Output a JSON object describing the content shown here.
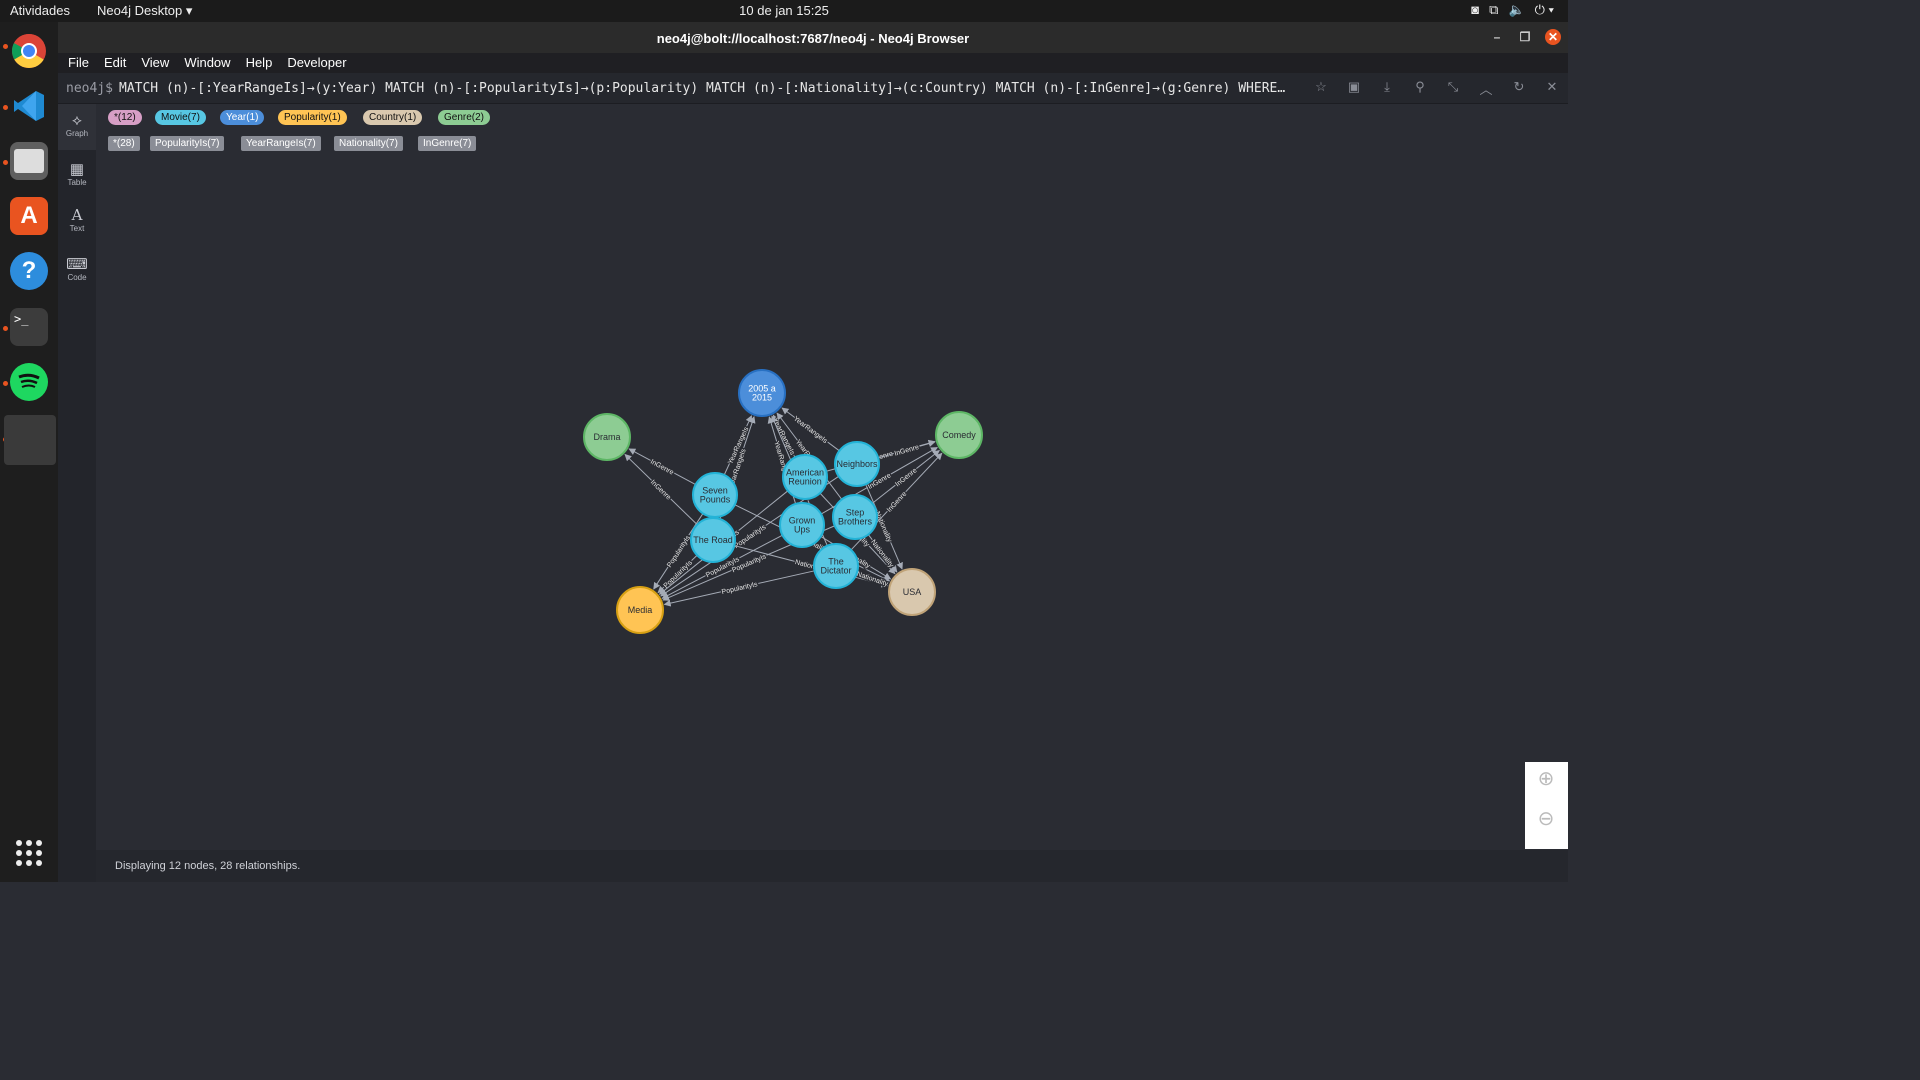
{
  "topbar": {
    "activities": "Atividades",
    "app_menu": "Neo4j Desktop ▾",
    "clock": "10 de jan  15:25"
  },
  "window": {
    "title": "neo4j@bolt://localhost:7687/neo4j - Neo4j Browser"
  },
  "menu": [
    "File",
    "Edit",
    "View",
    "Window",
    "Help",
    "Developer"
  ],
  "query": {
    "prompt": "neo4j$",
    "text": "MATCH (n)-[:YearRangeIs]→(y:Year) MATCH (n)-[:PopularityIs]→(p:Popularity) MATCH (n)-[:Nationality]→(c:Country) MATCH (n)-[:InGenre]→(g:Genre) WHERE…"
  },
  "view_modes": [
    "Graph",
    "Table",
    "Text",
    "Code"
  ],
  "node_labels": [
    {
      "text": "*(12)",
      "color": "#d79fc6"
    },
    {
      "text": "Movie(7)",
      "color": "#57c7e3"
    },
    {
      "text": "Year(1)",
      "color": "#4c8eda"
    },
    {
      "text": "Popularity(1)",
      "color": "#ffc454"
    },
    {
      "text": "Country(1)",
      "color": "#d9c8ae"
    },
    {
      "text": "Genre(2)",
      "color": "#8dcc93"
    }
  ],
  "rel_types": [
    "*(28)",
    "PopularityIs(7)",
    "YearRangeIs(7)",
    "Nationality(7)",
    "InGenre(7)"
  ],
  "graph": {
    "nodes": [
      {
        "id": "year",
        "label": [
          "2005 a",
          "2015"
        ],
        "color": "#4c8eda",
        "border": "#2870c2"
      },
      {
        "id": "drama",
        "label": [
          "Drama"
        ],
        "color": "#8dcc93",
        "border": "#5db665"
      },
      {
        "id": "comedy",
        "label": [
          "Comedy"
        ],
        "color": "#8dcc93",
        "border": "#5db665"
      },
      {
        "id": "media",
        "label": [
          "Media"
        ],
        "color": "#ffc454",
        "border": "#d7a013"
      },
      {
        "id": "usa",
        "label": [
          "USA"
        ],
        "color": "#d9c8ae",
        "border": "#c0a378"
      },
      {
        "id": "seven",
        "label": [
          "Seven",
          "Pounds"
        ],
        "color": "#57c7e3",
        "border": "#23b3d7"
      },
      {
        "id": "road",
        "label": [
          "The Road"
        ],
        "color": "#57c7e3",
        "border": "#23b3d7"
      },
      {
        "id": "american",
        "label": [
          "American",
          "Reunion"
        ],
        "color": "#57c7e3",
        "border": "#23b3d7"
      },
      {
        "id": "neighbors",
        "label": [
          "Neighbors"
        ],
        "color": "#57c7e3",
        "border": "#23b3d7"
      },
      {
        "id": "grown",
        "label": [
          "Grown",
          "Ups"
        ],
        "color": "#57c7e3",
        "border": "#23b3d7"
      },
      {
        "id": "step",
        "label": [
          "Step",
          "Brothers"
        ],
        "color": "#57c7e3",
        "border": "#23b3d7"
      },
      {
        "id": "dictator",
        "label": [
          "The",
          "Dictator"
        ],
        "color": "#57c7e3",
        "border": "#23b3d7"
      }
    ],
    "relationships": [
      {
        "from": "seven",
        "to": "year",
        "type": "YearRangeIs"
      },
      {
        "from": "road",
        "to": "year",
        "type": "YearRangeIs"
      },
      {
        "from": "american",
        "to": "year",
        "type": "YearRangeIs"
      },
      {
        "from": "neighbors",
        "to": "year",
        "type": "YearRangeIs"
      },
      {
        "from": "grown",
        "to": "year",
        "type": "YearRangeIs"
      },
      {
        "from": "step",
        "to": "year",
        "type": "YearRangeIs"
      },
      {
        "from": "dictator",
        "to": "year",
        "type": "YearRangeIs"
      },
      {
        "from": "seven",
        "to": "media",
        "type": "PopularityIs"
      },
      {
        "from": "road",
        "to": "media",
        "type": "PopularityIs"
      },
      {
        "from": "american",
        "to": "media",
        "type": "PopularityIs"
      },
      {
        "from": "neighbors",
        "to": "media",
        "type": "PopularityIs"
      },
      {
        "from": "grown",
        "to": "media",
        "type": "PopularityIs"
      },
      {
        "from": "step",
        "to": "media",
        "type": "PopularityIs"
      },
      {
        "from": "dictator",
        "to": "media",
        "type": "PopularityIs"
      },
      {
        "from": "seven",
        "to": "usa",
        "type": "Nationality"
      },
      {
        "from": "road",
        "to": "usa",
        "type": "Nationality"
      },
      {
        "from": "american",
        "to": "usa",
        "type": "Nationality"
      },
      {
        "from": "neighbors",
        "to": "usa",
        "type": "Nationality"
      },
      {
        "from": "grown",
        "to": "usa",
        "type": "Nationality"
      },
      {
        "from": "step",
        "to": "usa",
        "type": "Nationality"
      },
      {
        "from": "dictator",
        "to": "usa",
        "type": "Nationality"
      },
      {
        "from": "seven",
        "to": "drama",
        "type": "InGenre"
      },
      {
        "from": "road",
        "to": "drama",
        "type": "InGenre"
      },
      {
        "from": "american",
        "to": "comedy",
        "type": "InGenre"
      },
      {
        "from": "neighbors",
        "to": "comedy",
        "type": "InGenre"
      },
      {
        "from": "grown",
        "to": "comedy",
        "type": "InGenre"
      },
      {
        "from": "step",
        "to": "comedy",
        "type": "InGenre"
      },
      {
        "from": "dictator",
        "to": "comedy",
        "type": "InGenre"
      }
    ]
  },
  "footer": "Displaying 12 nodes, 28 relationships."
}
